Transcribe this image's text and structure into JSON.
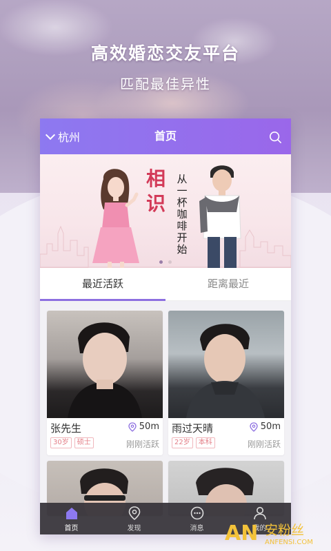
{
  "hero": {
    "title": "高效婚恋交友平台",
    "subtitle": "匹配最佳异性"
  },
  "header": {
    "city": "杭州",
    "title": "首页"
  },
  "banner": {
    "tagline_big": [
      "相",
      "识"
    ],
    "tagline_small": "从一杯咖啡开始",
    "slide_count": 2,
    "active_slide": 1
  },
  "tabs": [
    {
      "label": "最近活跃",
      "active": true
    },
    {
      "label": "距离最近",
      "active": false
    }
  ],
  "users": [
    {
      "name": "张先生",
      "distance": "50m",
      "tags": [
        "30岁",
        "硕士"
      ],
      "activity": "刚刚活跃"
    },
    {
      "name": "雨过天晴",
      "distance": "50m",
      "tags": [
        "22岁",
        "本科"
      ],
      "activity": "刚刚活跃"
    }
  ],
  "bottom_nav": [
    {
      "label": "首页",
      "icon": "home-icon",
      "active": true
    },
    {
      "label": "发现",
      "icon": "discover-icon",
      "active": false
    },
    {
      "label": "消息",
      "icon": "message-icon",
      "active": false
    },
    {
      "label": "我的",
      "icon": "profile-icon",
      "active": false
    }
  ],
  "watermark": {
    "logo": "AN",
    "brand_cn": "安粉丝",
    "brand_url": "ANFENSI.COM"
  },
  "colors": {
    "accent": "#8d79f0",
    "tag": "#e37d86",
    "tagline": "#d33a58",
    "nav_bg": "#37343a"
  }
}
